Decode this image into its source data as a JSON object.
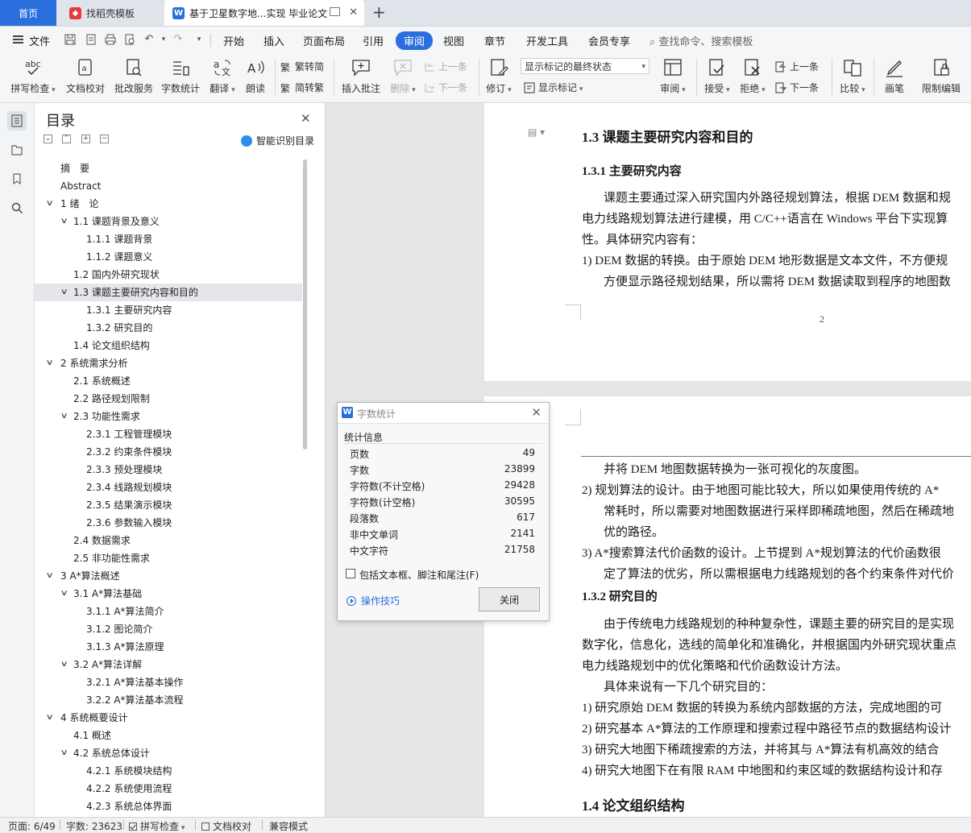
{
  "tabs": {
    "home": "首页",
    "template": "找稻壳模板",
    "document": "基于卫星数字地...实现 毕业论文"
  },
  "menu": {
    "file": "文件",
    "items": [
      "开始",
      "插入",
      "页面布局",
      "引用",
      "审阅",
      "视图",
      "章节",
      "开发工具",
      "会员专享"
    ],
    "active": "审阅",
    "search": "查找命令、搜索模板"
  },
  "ribbon": {
    "spell": "拼写检查",
    "proof": "文档校对",
    "batch": "批改服务",
    "wordcount": "字数统计",
    "translate": "翻译",
    "read": "朗读",
    "to_trad": "繁转简",
    "to_simp": "简转繁",
    "insert_comment": "插入批注",
    "delete": "删除",
    "prev": "上一条",
    "next": "下一条",
    "revise": "修订",
    "markup_combo": "显示标记的最终状态",
    "show_markup": "显示标记",
    "review": "审阅",
    "accept": "接受",
    "reject": "拒绝",
    "prev2": "上一条",
    "next2": "下一条",
    "compare": "比较",
    "pen": "画笔",
    "restrict": "限制编辑"
  },
  "toc": {
    "title": "目录",
    "smart": "智能识别目录",
    "items": [
      {
        "text": "摘　要",
        "level": 0,
        "chev": ""
      },
      {
        "text": "Abstract",
        "level": 0,
        "chev": ""
      },
      {
        "text": "1  绪　论",
        "level": 0,
        "chev": "v"
      },
      {
        "text": "1.1  课题背景及意义",
        "level": 1,
        "chev": "v"
      },
      {
        "text": "1.1.1  课题背景",
        "level": 2,
        "chev": ""
      },
      {
        "text": "1.1.2  课题意义",
        "level": 2,
        "chev": ""
      },
      {
        "text": "1.2  国内外研究现状",
        "level": 1,
        "chev": ""
      },
      {
        "text": "1.3  课题主要研究内容和目的",
        "level": 1,
        "chev": "v",
        "selected": true
      },
      {
        "text": "1.3.1  主要研究内容",
        "level": 2,
        "chev": ""
      },
      {
        "text": "1.3.2  研究目的",
        "level": 2,
        "chev": ""
      },
      {
        "text": "1.4  论文组织结构",
        "level": 1,
        "chev": ""
      },
      {
        "text": "2  系统需求分析",
        "level": 0,
        "chev": "v"
      },
      {
        "text": "2.1  系统概述",
        "level": 1,
        "chev": ""
      },
      {
        "text": "2.2  路径规划限制",
        "level": 1,
        "chev": ""
      },
      {
        "text": "2.3  功能性需求",
        "level": 1,
        "chev": "v"
      },
      {
        "text": "2.3.1  工程管理模块",
        "level": 2,
        "chev": ""
      },
      {
        "text": "2.3.2  约束条件模块",
        "level": 2,
        "chev": ""
      },
      {
        "text": "2.3.3  预处理模块",
        "level": 2,
        "chev": ""
      },
      {
        "text": "2.3.4  线路规划模块",
        "level": 2,
        "chev": ""
      },
      {
        "text": "2.3.5  结果演示模块",
        "level": 2,
        "chev": ""
      },
      {
        "text": "2.3.6  参数输入模块",
        "level": 2,
        "chev": ""
      },
      {
        "text": "2.4  数据需求",
        "level": 1,
        "chev": ""
      },
      {
        "text": "2.5  非功能性需求",
        "level": 1,
        "chev": ""
      },
      {
        "text": "3 A*算法概述",
        "level": 0,
        "chev": "v"
      },
      {
        "text": "3.1 A*算法基础",
        "level": 1,
        "chev": "v"
      },
      {
        "text": "3.1.1 A*算法简介",
        "level": 2,
        "chev": ""
      },
      {
        "text": "3.1.2  图论简介",
        "level": 2,
        "chev": ""
      },
      {
        "text": "3.1.3 A*算法原理",
        "level": 2,
        "chev": ""
      },
      {
        "text": "3.2 A*算法详解",
        "level": 1,
        "chev": "v"
      },
      {
        "text": "3.2.1 A*算法基本操作",
        "level": 2,
        "chev": ""
      },
      {
        "text": "3.2.2 A*算法基本流程",
        "level": 2,
        "chev": ""
      },
      {
        "text": "4  系统概要设计",
        "level": 0,
        "chev": "v"
      },
      {
        "text": "4.1  概述",
        "level": 1,
        "chev": ""
      },
      {
        "text": "4.2  系统总体设计",
        "level": 1,
        "chev": "v"
      },
      {
        "text": "4.2.1  系统模块结构",
        "level": 2,
        "chev": ""
      },
      {
        "text": "4.2.2  系统使用流程",
        "level": 2,
        "chev": ""
      },
      {
        "text": "4.2.3  系统总体界面",
        "level": 2,
        "chev": ""
      }
    ]
  },
  "doc": {
    "page1": {
      "h2": "1.3  课题主要研究内容和目的",
      "h3": "1.3.1  主要研究内容",
      "lines": [
        "课题主要通过深入研究国内外路径规划算法，根据 DEM 数据和规",
        "电力线路规划算法进行建模，用 C/C++语言在 Windows 平台下实现算",
        "性。具体研究内容有：",
        "1)    DEM 数据的转换。由于原始 DEM 地形数据是文本文件，不方便规",
        "方便显示路径规划结果，所以需将 DEM 数据读取到程序的地图数"
      ],
      "page_number": "2"
    },
    "page2": {
      "lines": [
        "并将 DEM 地图数据转换为一张可视化的灰度图。",
        "2)    规划算法的设计。由于地图可能比较大，所以如果使用传统的 A*",
        "常耗时，所以需要对地图数据进行采样即稀疏地图，然后在稀疏地",
        "优的路径。",
        "3)    A*搜索算法代价函数的设计。上节提到 A*规划算法的代价函数很",
        "定了算法的优劣，所以需根据电力线路规划的各个约束条件对代价"
      ],
      "h3": "1.3.2  研究目的",
      "lines2": [
        "由于传统电力线路规划的种种复杂性，课题主要的研究目的是实现",
        "数字化，信息化，选线的简单化和准确化，并根据国内外研究现状重点",
        "电力线路规划中的优化策略和代价函数设计方法。",
        "具体来说有一下几个研究目的：",
        "1)    研究原始 DEM 数据的转换为系统内部数据的方法，完成地图的可",
        "2)    研究基本 A*算法的工作原理和搜索过程中路径节点的数据结构设计",
        "3)    研究大地图下稀疏搜索的方法，并将其与 A*算法有机高效的结合",
        "4)    研究大地图下在有限 RAM 中地图和约束区域的数据结构设计和存"
      ],
      "h2": "1.4  论文组织结构"
    }
  },
  "dialog": {
    "title": "字数统计",
    "section": "统计信息",
    "stats": [
      {
        "label": "页数",
        "value": "49"
      },
      {
        "label": "字数",
        "value": "23899"
      },
      {
        "label": "字符数(不计空格)",
        "value": "29428"
      },
      {
        "label": "字符数(计空格)",
        "value": "30595"
      },
      {
        "label": "段落数",
        "value": "617"
      },
      {
        "label": "非中文单词",
        "value": "2141"
      },
      {
        "label": "中文字符",
        "value": "21758"
      }
    ],
    "checkbox": "包括文本框、脚注和尾注(F)",
    "tips": "操作技巧",
    "close": "关闭"
  },
  "status": {
    "page": "页面: 6/49",
    "words": "字数: 23623",
    "spell": "拼写检查",
    "proof": "文档校对",
    "compat": "兼容模式"
  },
  "colors": {
    "accent": "#2b6fde",
    "tab_bar": "#dfe3ea",
    "toc_selected": "#e4e6ea"
  }
}
